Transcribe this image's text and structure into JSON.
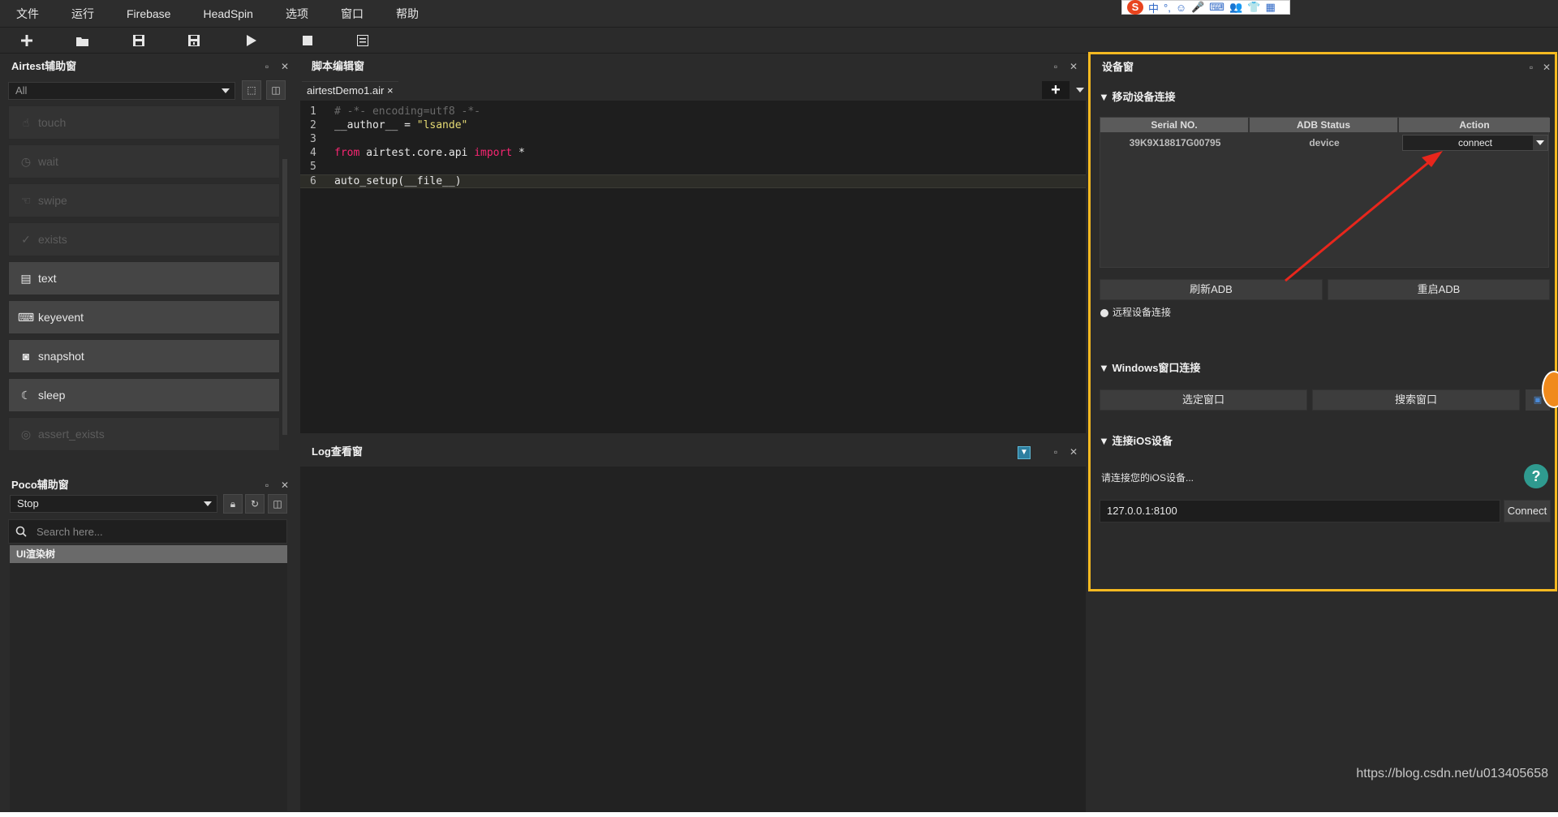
{
  "menu": [
    "文件",
    "运行",
    "Firebase",
    "HeadSpin",
    "选项",
    "窗口",
    "帮助"
  ],
  "ime": {
    "chars": [
      "中",
      "°,",
      "☺",
      "🎤",
      "⌨",
      "👥",
      "👕",
      "▦"
    ]
  },
  "toolbar": {
    "icons": [
      "plus-icon",
      "folder-open-icon",
      "save-icon",
      "save-as-icon",
      "play-icon",
      "stop-icon",
      "list-icon"
    ]
  },
  "airtest": {
    "title": "Airtest辅助窗",
    "filter_value": "All",
    "apis": [
      {
        "label": "touch",
        "enabled": false,
        "icon": "touch-icon"
      },
      {
        "label": "wait",
        "enabled": false,
        "icon": "clock-icon"
      },
      {
        "label": "swipe",
        "enabled": false,
        "icon": "swipe-icon"
      },
      {
        "label": "exists",
        "enabled": false,
        "icon": "check-circle-icon"
      },
      {
        "label": "text",
        "enabled": true,
        "icon": "text-icon"
      },
      {
        "label": "keyevent",
        "enabled": true,
        "icon": "keyboard-icon"
      },
      {
        "label": "snapshot",
        "enabled": true,
        "icon": "camera-icon"
      },
      {
        "label": "sleep",
        "enabled": true,
        "icon": "moon-icon"
      },
      {
        "label": "assert_exists",
        "enabled": false,
        "icon": "assert-icon"
      }
    ]
  },
  "poco": {
    "title": "Poco辅助窗",
    "mode_value": "Stop",
    "search_placeholder": "Search here...",
    "tree_root": "UI渲染树"
  },
  "editor": {
    "title": "脚本编辑窗",
    "tab_label": "airtestDemo1.air",
    "tab_close": "×",
    "lines": [
      {
        "n": "1",
        "parts": [
          {
            "t": "# -*- encoding=utf8 -*-",
            "c": "cm"
          }
        ]
      },
      {
        "n": "2",
        "parts": [
          {
            "t": "__author__ = ",
            "c": ""
          },
          {
            "t": "\"lsande\"",
            "c": "str"
          }
        ]
      },
      {
        "n": "3",
        "parts": []
      },
      {
        "n": "4",
        "parts": [
          {
            "t": "from",
            "c": "kw"
          },
          {
            "t": " airtest.core.api ",
            "c": ""
          },
          {
            "t": "import",
            "c": "kw"
          },
          {
            "t": " *",
            "c": ""
          }
        ]
      },
      {
        "n": "5",
        "parts": []
      },
      {
        "n": "6",
        "parts": [
          {
            "t": "auto_setup(__file__)",
            "c": ""
          }
        ]
      }
    ]
  },
  "log": {
    "title": "Log查看窗"
  },
  "device": {
    "title": "设备窗",
    "mobile_section": "移动设备连接",
    "columns": [
      "Serial NO.",
      "ADB Status",
      "Action"
    ],
    "rows": [
      {
        "serial": "39K9X18817G00795",
        "status": "device",
        "action": "connect"
      }
    ],
    "refresh_adb": "刷新ADB",
    "restart_adb": "重启ADB",
    "remote_label": "远程设备连接",
    "windows_section": "Windows窗口连接",
    "select_window": "选定窗口",
    "search_window": "搜索窗口",
    "ios_section": "连接iOS设备",
    "ios_hint": "请连接您的iOS设备...",
    "ios_address": "127.0.0.1:8100",
    "ios_connect": "Connect",
    "help": "?"
  },
  "watermark": "https://blog.csdn.net/u013405658",
  "colors": {
    "highlight_border": "#f5b921",
    "arrow": "#e8261c",
    "keyword": "#f92672",
    "string": "#e6db74"
  }
}
